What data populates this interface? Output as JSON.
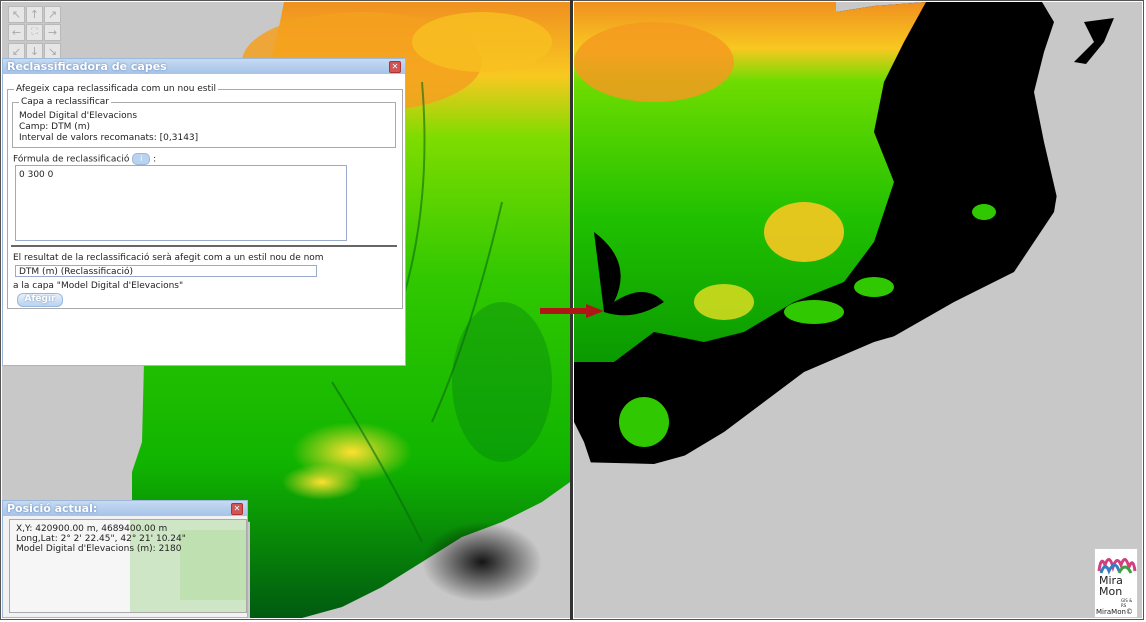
{
  "nav": {
    "arrows": [
      "↖",
      "↑",
      "↗",
      "←",
      "⛶",
      "→",
      "↙",
      "↓",
      "↘"
    ]
  },
  "reclass": {
    "title": "Reclassificadora de capes",
    "group_label": "Afegeix capa reclassificada com un nou estil",
    "layer_box_label": "Capa a reclassificar",
    "layer_name": "Model Digital d'Elevacions",
    "field": "Camp: DTM (m)",
    "range": "Interval de valors recomanats: [0,3143]",
    "formula_label": "Fórmula de reclassificació",
    "formula_value": "0 300 0",
    "result_text": "El resultat de la reclassificació serà afegit com a un estil nou de nom",
    "style_name": "DTM (m) (Reclassificació)",
    "layer_ref": "a la capa \"Model Digital d'Elevacions\"",
    "add_button": "Afegir",
    "info_label": "i",
    "colon": ":"
  },
  "position": {
    "title": "Posició actual:",
    "xy": "X,Y: 420900.00 m, 4689400.00 m",
    "lonlat": "Long,Lat: 2° 2' 22.45\", 42° 21' 10.24\"",
    "value": "Model Digital d'Elevacions (m): 2180"
  },
  "logo": {
    "line1": "Mira",
    "line2": "Mon",
    "footer": "MiraMon©",
    "small": "GIS & RS"
  },
  "colors": {
    "accent": "#a6c3e8",
    "arrow": "#b01616",
    "land_low": "#00c800",
    "land_high": "#ff9900"
  }
}
